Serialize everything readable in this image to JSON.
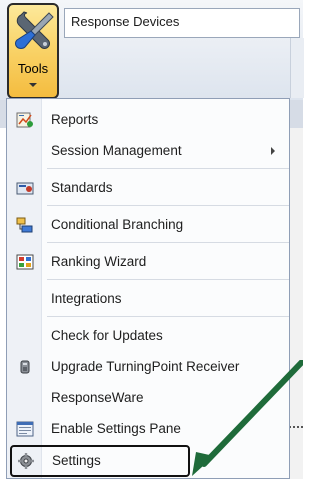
{
  "ribbon": {
    "tools_button": {
      "label": "Tools"
    },
    "response_devices_label": "Response Devices"
  },
  "menu": {
    "items": [
      {
        "label": "Reports",
        "icon": "reports-icon",
        "has_icon": true
      },
      {
        "label": "Session Management",
        "icon": "",
        "has_icon": false,
        "has_submenu": true
      },
      {
        "label": "Standards",
        "icon": "standards-icon",
        "has_icon": true
      },
      {
        "label": "Conditional Branching",
        "icon": "conditional-branching-icon",
        "has_icon": true
      },
      {
        "label": "Ranking Wizard",
        "icon": "ranking-wizard-icon",
        "has_icon": true
      },
      {
        "label": "Integrations",
        "icon": "",
        "has_icon": false
      },
      {
        "label": "Check for Updates",
        "icon": "",
        "has_icon": false
      },
      {
        "label": "Upgrade TurningPoint Receiver",
        "icon": "receiver-icon",
        "has_icon": true
      },
      {
        "label": "ResponseWare",
        "icon": "",
        "has_icon": false
      },
      {
        "label": "Enable Settings Pane",
        "icon": "settings-pane-icon",
        "has_icon": true
      },
      {
        "label": "Settings",
        "icon": "gear-icon",
        "has_icon": true,
        "highlighted": true
      }
    ]
  },
  "colors": {
    "tools_button_gradient": [
      "#fde99b",
      "#f4bc3f"
    ],
    "menu_background": "#fbfcfd",
    "menu_gutter": "#eef1f6",
    "annotation_arrow": "#1f6b3a",
    "highlight_border": "#111111"
  }
}
